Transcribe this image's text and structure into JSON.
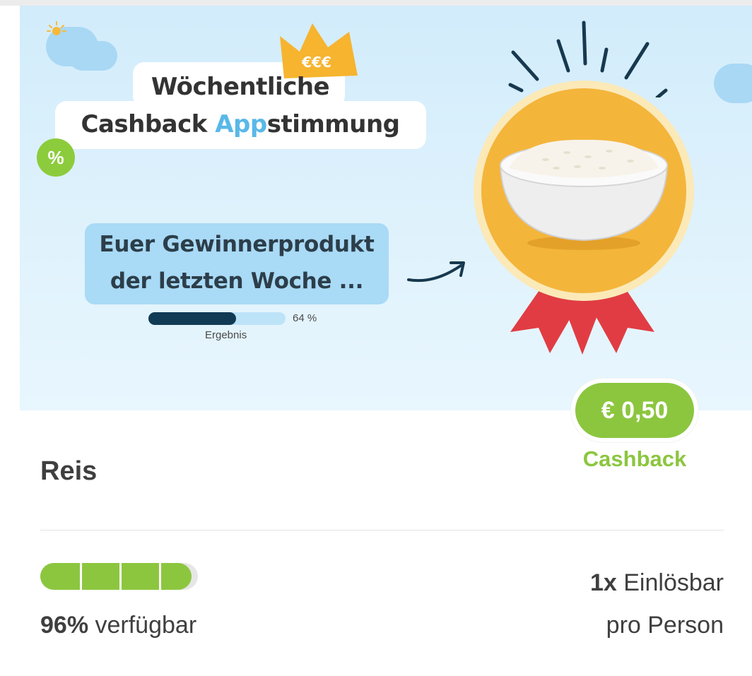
{
  "banner": {
    "title_line1": "Wöchentliche",
    "title_line2_part1": "Cashback ",
    "title_line2_accent": "App",
    "title_line2_part2": "stimmung",
    "crown_text": "€€€",
    "percent_badge": "%",
    "winner_line1": "Euer Gewinnerprodukt",
    "winner_line2": "der letzten Woche ...",
    "result_percent_label": "64 %",
    "result_fraction": 0.64,
    "result_label": "Ergebnis",
    "accent_color": "#5ab8e8"
  },
  "cashback": {
    "amount": "€ 0,50",
    "label": "Cashback",
    "color": "#8cc63f"
  },
  "product": {
    "name": "Reis"
  },
  "availability": {
    "percent_value": "96%",
    "percent_fraction": 0.96,
    "suffix": " verfügbar",
    "segments": 4
  },
  "redeem": {
    "count": "1x",
    "label": " Einlösbar",
    "line2": "pro Person"
  }
}
